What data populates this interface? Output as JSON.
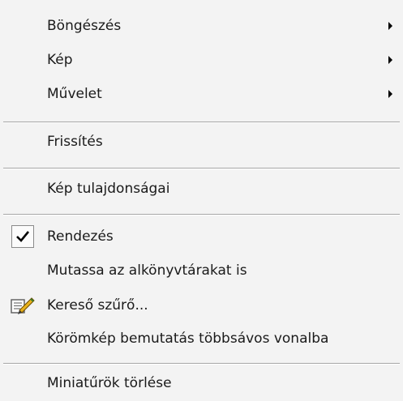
{
  "menu": {
    "items": [
      {
        "label": "Böngészés",
        "submenu": true
      },
      {
        "label": "Kép",
        "submenu": true
      },
      {
        "label": "Művelet",
        "submenu": true
      },
      {
        "label": "Frissítés",
        "submenu": false
      },
      {
        "label": "Kép tulajdonságai",
        "submenu": false
      },
      {
        "label": "Rendezés",
        "checked": true
      },
      {
        "label": "Mutassa az alkönyvtárakat is",
        "checked": false
      },
      {
        "label": "Kereső szűrő...",
        "icon": "filter-edit-icon"
      },
      {
        "label": "Körömkép bemutatás többsávos vonalba",
        "checked": false
      },
      {
        "label": "Miniatűrök törlése",
        "checked": false
      }
    ]
  },
  "icons": {
    "submenu_arrow": "chevron-right-icon",
    "check": "checkmark-icon",
    "filter": "filter-edit-icon"
  },
  "colors": {
    "background": "#f3f3f3",
    "separator": "#a6a6a6",
    "text": "#1a1a1a"
  }
}
